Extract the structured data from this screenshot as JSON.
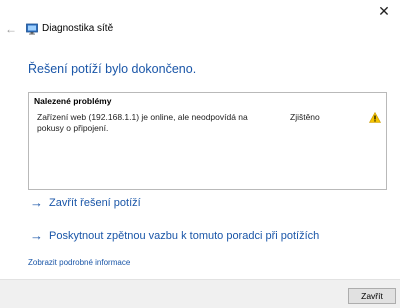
{
  "window": {
    "title": "Diagnostika sítě",
    "close_glyph": "✕",
    "back_glyph": "←"
  },
  "main": {
    "heading": "Řešení potíží bylo dokončeno."
  },
  "problems": {
    "header": "Nalezené problémy",
    "items": [
      {
        "description": "Zařízení web (192.168.1.1) je online, ale neodpovídá na pokusy o připojení.",
        "status": "Zjištěno",
        "icon": "warning-icon"
      }
    ]
  },
  "links": {
    "close_troubleshooting": "Zavřít řešení potíží",
    "feedback": "Poskytnout zpětnou vazbu k tomuto poradci při potížích",
    "arrow_glyph": "→",
    "details": "Zobrazit podrobné informace"
  },
  "footer": {
    "close_button": "Zavřít"
  },
  "colors": {
    "accent_blue": "#1a56a8",
    "warning_yellow": "#f5c400",
    "footer_bg": "#f0f0f0"
  }
}
